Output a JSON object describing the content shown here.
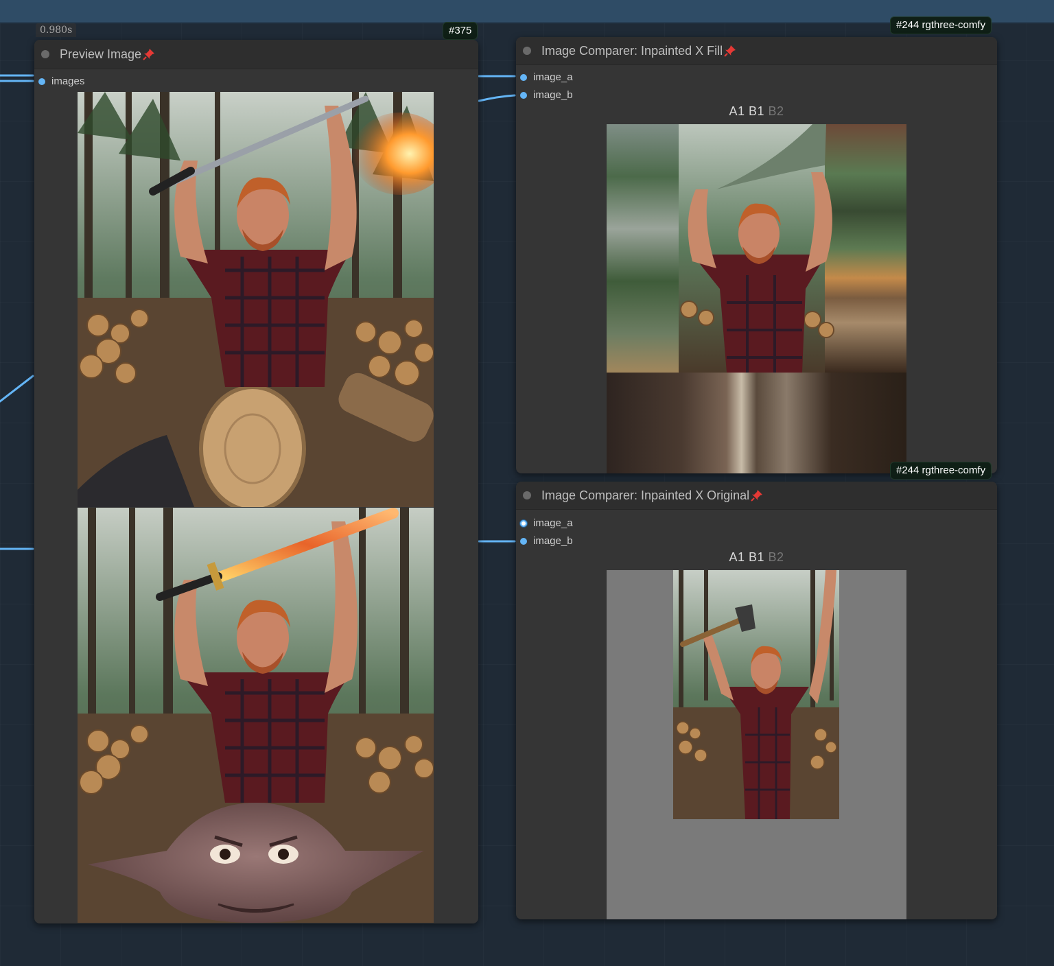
{
  "execution_time": "0.980s",
  "preview_node": {
    "id_badge": "#375",
    "title": "Preview Image",
    "input_label": "images",
    "images": [
      "lumberjack raising flaming sword in pine forest",
      "lumberjack with flaming sword and goblin face in foreground"
    ]
  },
  "comparer_fill": {
    "id_badge": "#244 rgthree-comfy",
    "title": "Image Comparer: Inpainted X Fill",
    "inputs": [
      "image_a",
      "image_b"
    ],
    "label_a1": "A1",
    "label_b1": "B1",
    "label_b2": "B2",
    "image": "lumberjack with fist raised, smeared inpaint fill edges"
  },
  "comparer_original": {
    "id_badge": "#244 rgthree-comfy",
    "title": "Image Comparer: Inpainted X Original",
    "inputs": [
      "image_a",
      "image_b"
    ],
    "label_a1": "A1",
    "label_b1": "B1",
    "label_b2": "B2",
    "image": "lumberjack holding axe on gray padded canvas"
  },
  "colors": {
    "canvas": "#1f2a36",
    "topbar": "#2f4c66",
    "node_body": "#353535",
    "node_header": "#2e2e2e",
    "wire": "#64b5f6",
    "badge": "#0f1f16",
    "pin": "#e53935",
    "pad_gray": "#7a7a7a"
  }
}
